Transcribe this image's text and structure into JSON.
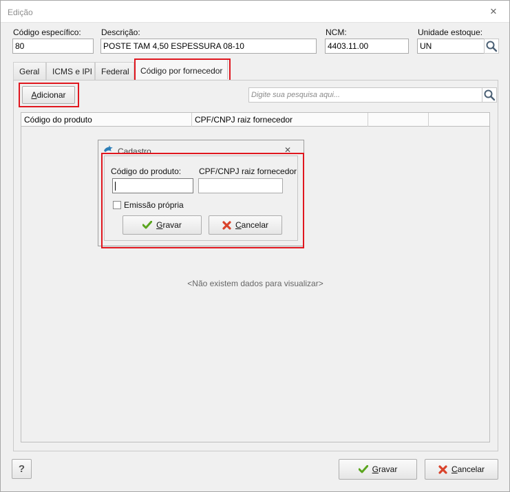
{
  "window": {
    "title": "Edição",
    "close_glyph": "✕"
  },
  "fields": {
    "codigo": {
      "label": "Código específico:",
      "value": "80"
    },
    "descricao": {
      "label": "Descrição:",
      "value": "POSTE TAM 4,50 ESPESSURA 08-10"
    },
    "ncm": {
      "label": "NCM:",
      "value": "4403.11.00"
    },
    "unidade": {
      "label": "Unidade estoque:",
      "value": "UN"
    }
  },
  "tabs": [
    "Geral",
    "ICMS e IPI",
    "Federal",
    "Código por fornecedor"
  ],
  "toolbar": {
    "add_label_first": "A",
    "add_label_rest": "dicionar",
    "search_placeholder": "Digite sua pesquisa aqui..."
  },
  "grid": {
    "columns": [
      "Código do produto",
      "CPF/CNPJ raiz fornecedor",
      "",
      ""
    ],
    "empty_text": "<Não existem dados para visualizar>"
  },
  "dialog": {
    "title": "Cadastro",
    "codigo_label": "Código do produto:",
    "cnpj_label": "CPF/CNPJ raiz fornecedor",
    "codigo_value": "",
    "cnpj_value": "",
    "emissao_label": "Emissão própria",
    "gravar_first": "G",
    "gravar_rest": "ravar",
    "cancelar_first": "C",
    "cancelar_rest": "ancelar"
  },
  "footer": {
    "help_label": "?",
    "gravar_first": "G",
    "gravar_rest": "ravar",
    "cancelar_first": "C",
    "cancelar_rest": "ancelar"
  },
  "colors": {
    "highlight": "#e0161e",
    "check_green": "#5aa51e",
    "cancel_red": "#d9432b"
  },
  "icons": [
    "close-icon",
    "search-icon",
    "check-icon",
    "cancel-x-icon",
    "dolphin-app-icon"
  ]
}
